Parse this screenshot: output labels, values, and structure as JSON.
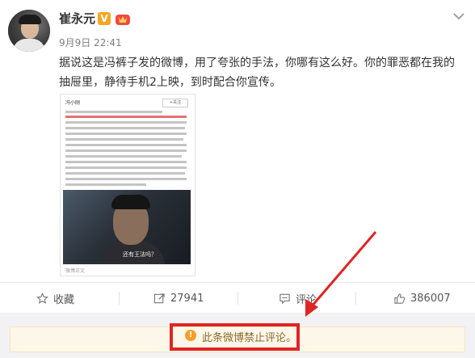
{
  "post": {
    "username": "崔永元",
    "verified_badge": "V",
    "timestamp": "9月9日 22:41",
    "text": "据说这是冯裤子发的微博，用了夸张的手法，你哪有这么好。你的罪恶都在我的抽屉里，静待手机2上映，到时配合你宣传。",
    "image_subtitle": "还有王法吗？",
    "image_name": "冯小刚",
    "image_follow": "+关注",
    "image_caption": "微博正文"
  },
  "actions": {
    "favorite_label": "收藏",
    "repost_count": "27941",
    "comment_label": "评论",
    "like_count": "386007"
  },
  "notice": {
    "text": "此条微博禁止评论。",
    "icon": "!"
  },
  "colors": {
    "highlight_red": "#e02525",
    "notice_orange": "#f29f2b",
    "badge_orange": "#f6a623"
  }
}
